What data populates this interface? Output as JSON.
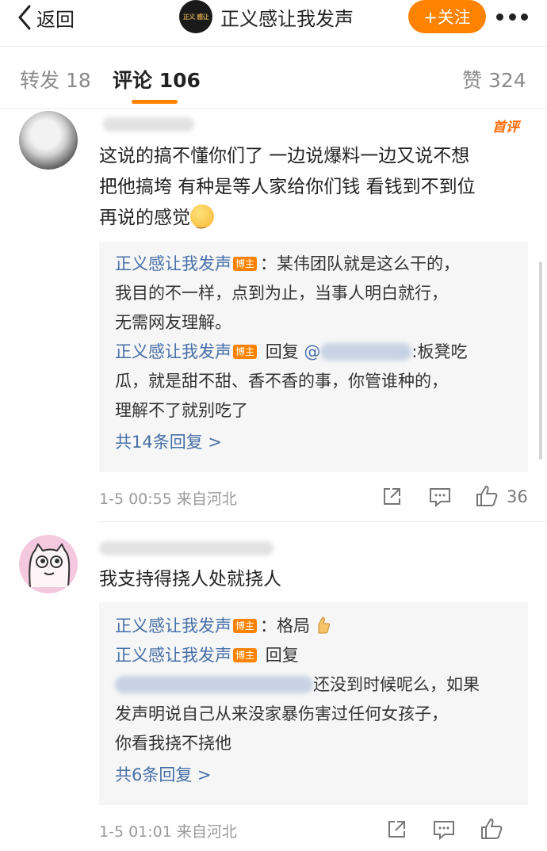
{
  "header": {
    "back_label": "返回",
    "logo_text": "正义 感让",
    "title": "正义感让我发声",
    "follow_label": "+关注"
  },
  "tabs": [
    {
      "label": "转发 18"
    },
    {
      "label": "评论 106"
    },
    {
      "label": "赞 324"
    }
  ],
  "comments": [
    {
      "badge": "首评",
      "text_line1": "这说的搞不懂你们了 一边说爆料一边又说不想",
      "text_line2": "把他搞垮 有种是等人家给你们钱 看钱到不到位",
      "text_line3": "再说的感觉",
      "replies": [
        {
          "name": "正义感让我发声",
          "badge": "博主",
          "line1": "：某伟团队就是这么干的，",
          "line2": "我目的不一样，点到为止，当事人明白就行，",
          "line3": "无需网友理解。"
        },
        {
          "name": "正义感让我发声",
          "badge": "博主",
          "reply_word": " 回复 ",
          "at": "@",
          "line1_tail": ":板凳吃",
          "line2": "瓜，就是甜不甜、香不香的事，你管谁种的，",
          "line3": "理解不了就别吃了"
        }
      ],
      "more_replies": "共14条回复 >",
      "time": "1-5 00:55",
      "location": "来自河北",
      "likes": "36"
    },
    {
      "text_line1": "我支持得挠人处就挠人",
      "replies": [
        {
          "name": "正义感让我发声",
          "badge": "博主",
          "line1": "：格局"
        },
        {
          "name": "正义感让我发声",
          "badge": "博主",
          "reply_word": " 回复",
          "line2_tail": "还没到时候呢么，如果",
          "line3": "发声明说自己从来没家暴伤害过任何女孩子，",
          "line4": "你看我挠不挠他"
        }
      ],
      "more_replies": "共6条回复 >",
      "time": "1-5 01:01",
      "location": "来自河北"
    }
  ],
  "colors": {
    "accent": "#ff8200",
    "link": "#466fa8",
    "reply_bg": "#f6f6f6"
  }
}
